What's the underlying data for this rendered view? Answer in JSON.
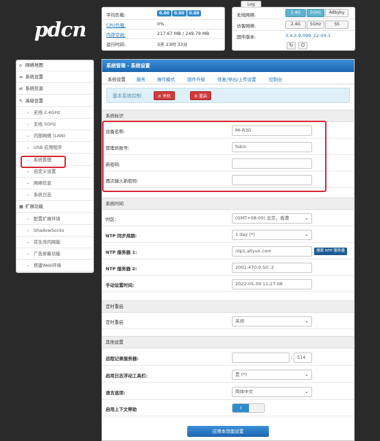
{
  "logo": "pdcn",
  "log_button": "Log",
  "stats": {
    "load_label": "平均负载:",
    "load_values": [
      "0.00",
      "0.00",
      "0.00"
    ],
    "cpu_label": "CPU负载:",
    "cpu_value": "0%",
    "mem_label": "内存空闲:",
    "mem_value": "217.67 MB / 249.79 MB",
    "uptime_label": "运行时间:",
    "uptime_value": "3天 23时 33分"
  },
  "network": {
    "wireless_label": "无线网络:",
    "wireless_opts": [
      "2.4G",
      "5GHz",
      "Adbyby"
    ],
    "guest_label": "访客网络:",
    "guest_opts": [
      "2.4G",
      "5GHz",
      "SS"
    ],
    "firmware_label": "固件版本:",
    "firmware_value": "3.4.3.9-099_22-04-1"
  },
  "sidebar": {
    "items": [
      {
        "icon": "home-icon",
        "glyph": "⌂",
        "label": "网络地图",
        "type": "top"
      },
      {
        "icon": "list-icon",
        "glyph": "≡",
        "label": "系统设置",
        "type": "top"
      },
      {
        "icon": "shuffle-icon",
        "glyph": "⇄",
        "label": "系统信息",
        "type": "top"
      },
      {
        "icon": "wrench-icon",
        "glyph": "✎",
        "label": "高级设置",
        "type": "top"
      },
      {
        "label": "无线 2.4GHz",
        "type": "sub"
      },
      {
        "label": "无线 5GHz",
        "type": "sub"
      },
      {
        "label": "内部网络 (LAN)",
        "type": "sub"
      },
      {
        "label": "USB 应用程序",
        "type": "sub"
      },
      {
        "label": "系统管理",
        "type": "sub"
      },
      {
        "label": "自定义设置",
        "type": "sub"
      },
      {
        "label": "网络信息",
        "type": "sub"
      },
      {
        "label": "系统日志",
        "type": "sub"
      },
      {
        "icon": "grid-icon",
        "glyph": "▦",
        "label": "扩展功能",
        "type": "top"
      },
      {
        "label": "配置扩展环境",
        "type": "sub"
      },
      {
        "label": "ShadowSocks",
        "type": "sub"
      },
      {
        "label": "花生壳内网版",
        "type": "sub"
      },
      {
        "label": "广告屏蔽功能",
        "type": "sub"
      },
      {
        "label": "搭建Web环境",
        "type": "sub"
      }
    ]
  },
  "main": {
    "title": "系统管理 - 系统设置",
    "tabs": [
      "系统设置",
      "服务",
      "操作模式",
      "固件升级",
      "恢复/导出/上传设置",
      "控制台"
    ],
    "control_label": "基本系统控制",
    "shutdown_label": "关机",
    "reboot_label": "重启",
    "section_identity": "系统标识",
    "device_name_label": "设备名称:",
    "device_name_value": "MI-R3G",
    "admin_label": "管理员账号:",
    "admin_value": "fobin",
    "newpass_label": "新密码:",
    "newpass_value": "",
    "repass_label": "再次输入新密码:",
    "repass_value": "",
    "section_time": "系统时间",
    "tz_label": "时区:",
    "tz_value": "(GMT+08:00) 北京，香港",
    "ntp_period_label": "NTP 同步周期:",
    "ntp_period_value": "1 day (*)",
    "ntp1_label": "NTP 服务器 1:",
    "ntp1_value": "ntp1.aliyun.com",
    "ntp_search": "搜索 NTP 服务器",
    "ntp2_label": "NTP 服务器 2:",
    "ntp2_value": "2001:470:0:50::2",
    "manual_label": "手动设置时间:",
    "manual_value": "2022-05-09 11:27:08",
    "section_reboot": "定时重启",
    "reboot_sched_label": "定时重启",
    "reboot_sched_value": "关闭",
    "section_other": "其他设置",
    "syslog_label": "远程记录服务器:",
    "syslog_value": "",
    "syslog_port": "514",
    "float_label": "启用日志浮动工具栏:",
    "float_value": "是 (*)",
    "lang_label": "语言选项:",
    "lang_value": "简体中文",
    "help_label": "启用上下文帮助",
    "help_toggle": "I",
    "apply_label": "应用本页面设置"
  }
}
